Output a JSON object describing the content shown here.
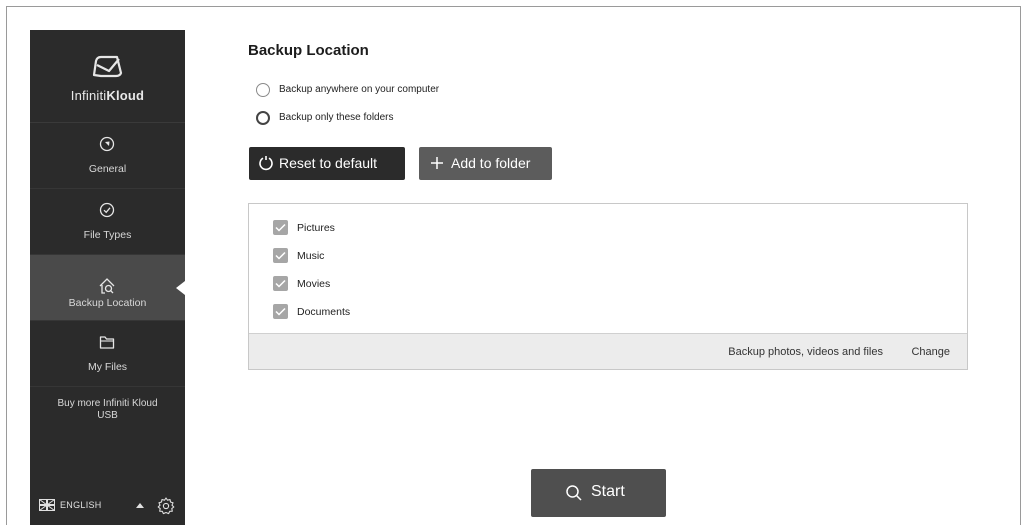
{
  "app": {
    "brand_light": "Infiniti",
    "brand_bold": "Kloud"
  },
  "sidebar": {
    "items": [
      {
        "label": "General",
        "icon": "compass-icon"
      },
      {
        "label": "File Types",
        "icon": "check-circle-icon"
      },
      {
        "label": "Backup Location",
        "icon": "home-search-icon",
        "active": true
      },
      {
        "label": "My Files",
        "icon": "folder-icon"
      }
    ],
    "buy_more": "Buy more Infiniti Kloud USB",
    "language": "ENGLISH"
  },
  "main": {
    "title": "Backup Location",
    "radios": [
      {
        "label": "Backup anywhere on your computer",
        "checked": false
      },
      {
        "label": "Backup only these folders",
        "checked": true
      }
    ],
    "buttons": {
      "reset": "Reset to default",
      "add": "Add to folder",
      "start": "Start"
    },
    "folders": [
      {
        "label": "Pictures",
        "checked": true
      },
      {
        "label": "Music",
        "checked": true
      },
      {
        "label": "Movies",
        "checked": true
      },
      {
        "label": "Documents",
        "checked": true
      }
    ],
    "footer": {
      "text": "Backup photos, videos and files",
      "link": "Change"
    }
  },
  "colors": {
    "sidebar_bg": "#2b2b2b",
    "sidebar_active": "#4a4a4a",
    "button_dark": "#2b2b2b",
    "button_mid": "#5c5c5c",
    "checkbox": "#a6a6a6"
  }
}
